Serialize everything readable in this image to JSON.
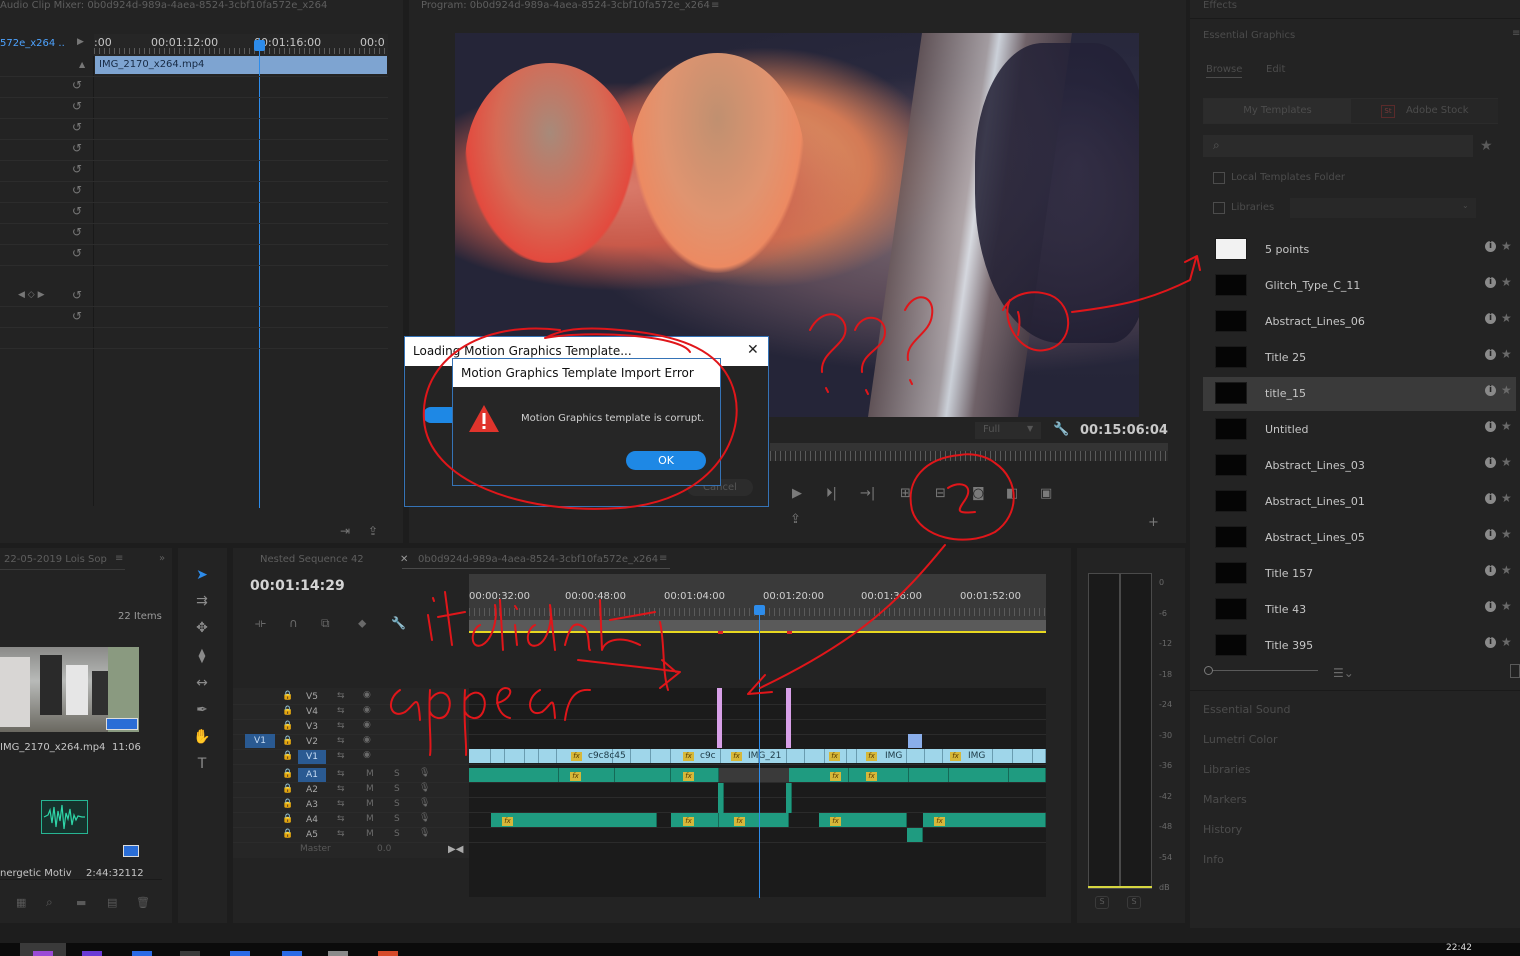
{
  "mixer": {
    "title": "Audio Clip Mixer: 0b0d924d-989a-4aea-8524-3cbf10fa572e_x264",
    "seq_tab": "572e_x264 ..",
    "timecodes": [
      ":00",
      "00:01:12:00",
      "00:01:16:00",
      "00:0"
    ],
    "clip_name": "IMG_2170_x264.mp4"
  },
  "program": {
    "title": "Program: 0b0d924d-989a-4aea-8524-3cbf10fa572e_x264",
    "quality": "Full",
    "timecode": "00:15:06:04"
  },
  "effects_tab": "Effects",
  "essential_graphics": {
    "title": "Essential Graphics",
    "tabs": [
      "Browse",
      "Edit"
    ],
    "sources": [
      "My Templates",
      "Adobe Stock"
    ],
    "stock_badge": "St",
    "search_placeholder": "",
    "local_folder_label": "Local Templates Folder",
    "libraries_label": "Libraries",
    "templates": [
      {
        "name": "5 points"
      },
      {
        "name": "Glitch_Type_C_11"
      },
      {
        "name": "Abstract_Lines_06"
      },
      {
        "name": "Title 25"
      },
      {
        "name": "title_15"
      },
      {
        "name": "Untitled"
      },
      {
        "name": "Abstract_Lines_03"
      },
      {
        "name": "Abstract_Lines_01"
      },
      {
        "name": "Abstract_Lines_05"
      },
      {
        "name": "Title 157"
      },
      {
        "name": "Title 43"
      },
      {
        "name": "Title 395"
      }
    ]
  },
  "right_sections": [
    "Essential Sound",
    "Lumetri Color",
    "Libraries",
    "Markers",
    "History",
    "Info"
  ],
  "project": {
    "tab": "22-05-2019 Lois Sop",
    "item_count": "22 Items",
    "clip1_name": "IMG_2170_x264.mp4",
    "clip1_duration": "11:06",
    "clip2_name": "nergetic Motiv",
    "clip2_duration": "2:44:32112"
  },
  "timeline": {
    "tabs": [
      "Nested Sequence 42",
      "0b0d924d-989a-4aea-8524-3cbf10fa572e_x264"
    ],
    "timecode": "00:01:14:29",
    "ruler": [
      "00:00:32:00",
      "00:00:48:00",
      "00:01:04:00",
      "00:01:20:00",
      "00:01:36:00",
      "00:01:52:00"
    ],
    "video_tracks": [
      "V5",
      "V4",
      "V3",
      "V2",
      "V1"
    ],
    "audio_tracks": [
      "A1",
      "A2",
      "A3",
      "A4",
      "A5"
    ],
    "source_patch": "V1",
    "master_label": "Master",
    "master_value": "0.0",
    "clip_labels": [
      "c9c8c45",
      "c9c",
      "IMG_21",
      "IMG",
      "IMG"
    ],
    "mute_label": "M",
    "solo_label": "S"
  },
  "meter": {
    "labels": [
      "0",
      "-6",
      "-12",
      "-18",
      "-24",
      "-30",
      "-36",
      "-42",
      "-48",
      "-54",
      "dB"
    ],
    "solo_buttons": [
      "S",
      "S"
    ]
  },
  "dialog_loading": {
    "title": "Loading Motion Graphics Template...",
    "close_glyph": "✕"
  },
  "dialog_error": {
    "title": "Motion Graphics Template Import Error",
    "message": "Motion Graphics template is corrupt.",
    "ok_label": "OK",
    "behind_button": "Cancel"
  },
  "annotation_text": "it didn't appear",
  "clock": "22:42"
}
